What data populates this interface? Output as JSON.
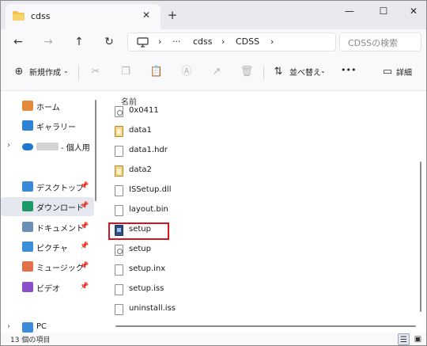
{
  "window": {
    "tab_title": "cdss",
    "close_tab": "✕",
    "new_tab": "+",
    "minimize": "—",
    "maximize": "☐",
    "close": "✕"
  },
  "nav": {
    "back": "←",
    "forward": "→",
    "up": "↑",
    "refresh": "↻",
    "breadcrumb": [
      "cdss",
      "CDSS"
    ],
    "search_placeholder": "CDSSの検索"
  },
  "toolbar": {
    "new_label": "新規作成",
    "sort_label": "並べ替え",
    "more_label": "•••",
    "details_label": "詳細"
  },
  "sidebar": {
    "items": [
      {
        "label": "ホーム",
        "icon": "home-icon",
        "chevron": false,
        "pinned": false,
        "selected": false
      },
      {
        "label": "ギャラリー",
        "icon": "gallery-icon",
        "chevron": false,
        "pinned": false,
        "selected": false
      },
      {
        "label": "- 個人用",
        "icon": "onedrive-cloud-icon",
        "chevron": true,
        "pinned": false,
        "selected": false
      },
      {
        "label": "デスクトップ",
        "icon": "desktop-icon",
        "chevron": false,
        "pinned": true,
        "selected": false
      },
      {
        "label": "ダウンロード",
        "icon": "download-icon",
        "chevron": false,
        "pinned": true,
        "selected": true
      },
      {
        "label": "ドキュメント",
        "icon": "documents-icon",
        "chevron": false,
        "pinned": true,
        "selected": false
      },
      {
        "label": "ピクチャ",
        "icon": "pictures-icon",
        "chevron": false,
        "pinned": true,
        "selected": false
      },
      {
        "label": "ミュージック",
        "icon": "music-icon",
        "chevron": false,
        "pinned": true,
        "selected": false
      },
      {
        "label": "ビデオ",
        "icon": "videos-icon",
        "chevron": false,
        "pinned": true,
        "selected": false
      },
      {
        "label": "PC",
        "icon": "pc-icon",
        "chevron": true,
        "pinned": false,
        "selected": false
      }
    ]
  },
  "files": {
    "column_name": "名前",
    "items": [
      {
        "name": "0x0411",
        "icon": "gear"
      },
      {
        "name": "data1",
        "icon": "data"
      },
      {
        "name": "data1.hdr",
        "icon": "file"
      },
      {
        "name": "data2",
        "icon": "data"
      },
      {
        "name": "ISSetup.dll",
        "icon": "file"
      },
      {
        "name": "layout.bin",
        "icon": "file"
      },
      {
        "name": "setup",
        "icon": "exe"
      },
      {
        "name": "setup",
        "icon": "gear"
      },
      {
        "name": "setup.inx",
        "icon": "file"
      },
      {
        "name": "setup.iss",
        "icon": "file"
      },
      {
        "name": "uninstall.iss",
        "icon": "file"
      }
    ]
  },
  "status": {
    "count_text": "13 個の項目"
  }
}
